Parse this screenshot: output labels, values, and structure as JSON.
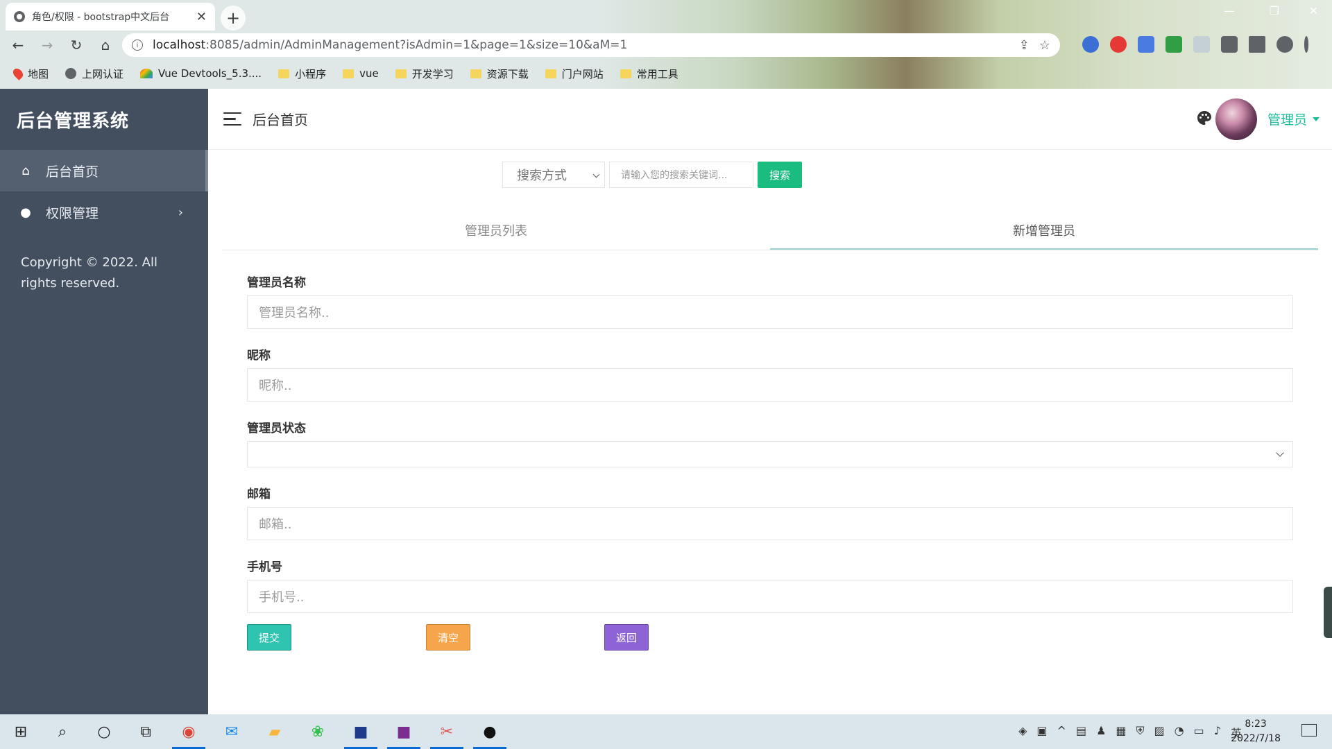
{
  "browser": {
    "tab_title": "角色/权限 - bootstrap中文后台",
    "tab_close": "✕",
    "new_tab": "+",
    "url_host": "localhost",
    "url_path": ":8085/admin/AdminManagement?isAdmin=1&page=1&size=10&aM=1",
    "bookmarks": [
      {
        "label": "地图",
        "icon": "map-pin-icon"
      },
      {
        "label": "上网认证",
        "icon": "globe-icon"
      },
      {
        "label": "Vue Devtools_5.3....",
        "icon": "vue-icon"
      },
      {
        "label": "小程序",
        "icon": "folder-icon"
      },
      {
        "label": "vue",
        "icon": "folder-icon"
      },
      {
        "label": "开发学习",
        "icon": "folder-icon"
      },
      {
        "label": "资源下载",
        "icon": "folder-icon"
      },
      {
        "label": "门户网站",
        "icon": "folder-icon"
      },
      {
        "label": "常用工具",
        "icon": "folder-icon"
      }
    ]
  },
  "sidebar": {
    "brand": "后台管理系统",
    "items": [
      {
        "label": "后台首页",
        "icon": "home-icon"
      },
      {
        "label": "权限管理",
        "icon": "palette-icon"
      }
    ],
    "copyright": "Copyright © 2022. All rights reserved."
  },
  "header": {
    "breadcrumb": "后台首页",
    "user_label": "管理员"
  },
  "search": {
    "select_label": "搜索方式",
    "input_placeholder": "请输入您的搜索关键词...",
    "button": "搜索"
  },
  "tabs": [
    {
      "label": "管理员列表",
      "active": false
    },
    {
      "label": "新增管理员",
      "active": true
    }
  ],
  "form": {
    "name_label": "管理员名称",
    "name_placeholder": "管理员名称..",
    "nickname_label": "昵称",
    "nickname_placeholder": "昵称..",
    "status_label": "管理员状态",
    "email_label": "邮箱",
    "email_placeholder": "邮箱..",
    "phone_label": "手机号",
    "phone_placeholder": "手机号..",
    "submit": "提交",
    "clear": "清空",
    "back": "返回"
  },
  "taskbar": {
    "time": "8:23",
    "date": "2022/7/18",
    "ime": "英"
  },
  "colors": {
    "accent": "#1abc9c",
    "sidebar": "#434e5f",
    "search_button": "#1abc80",
    "submit": "#2ec4b0",
    "clear": "#f7a54a",
    "back": "#8e63d6"
  }
}
